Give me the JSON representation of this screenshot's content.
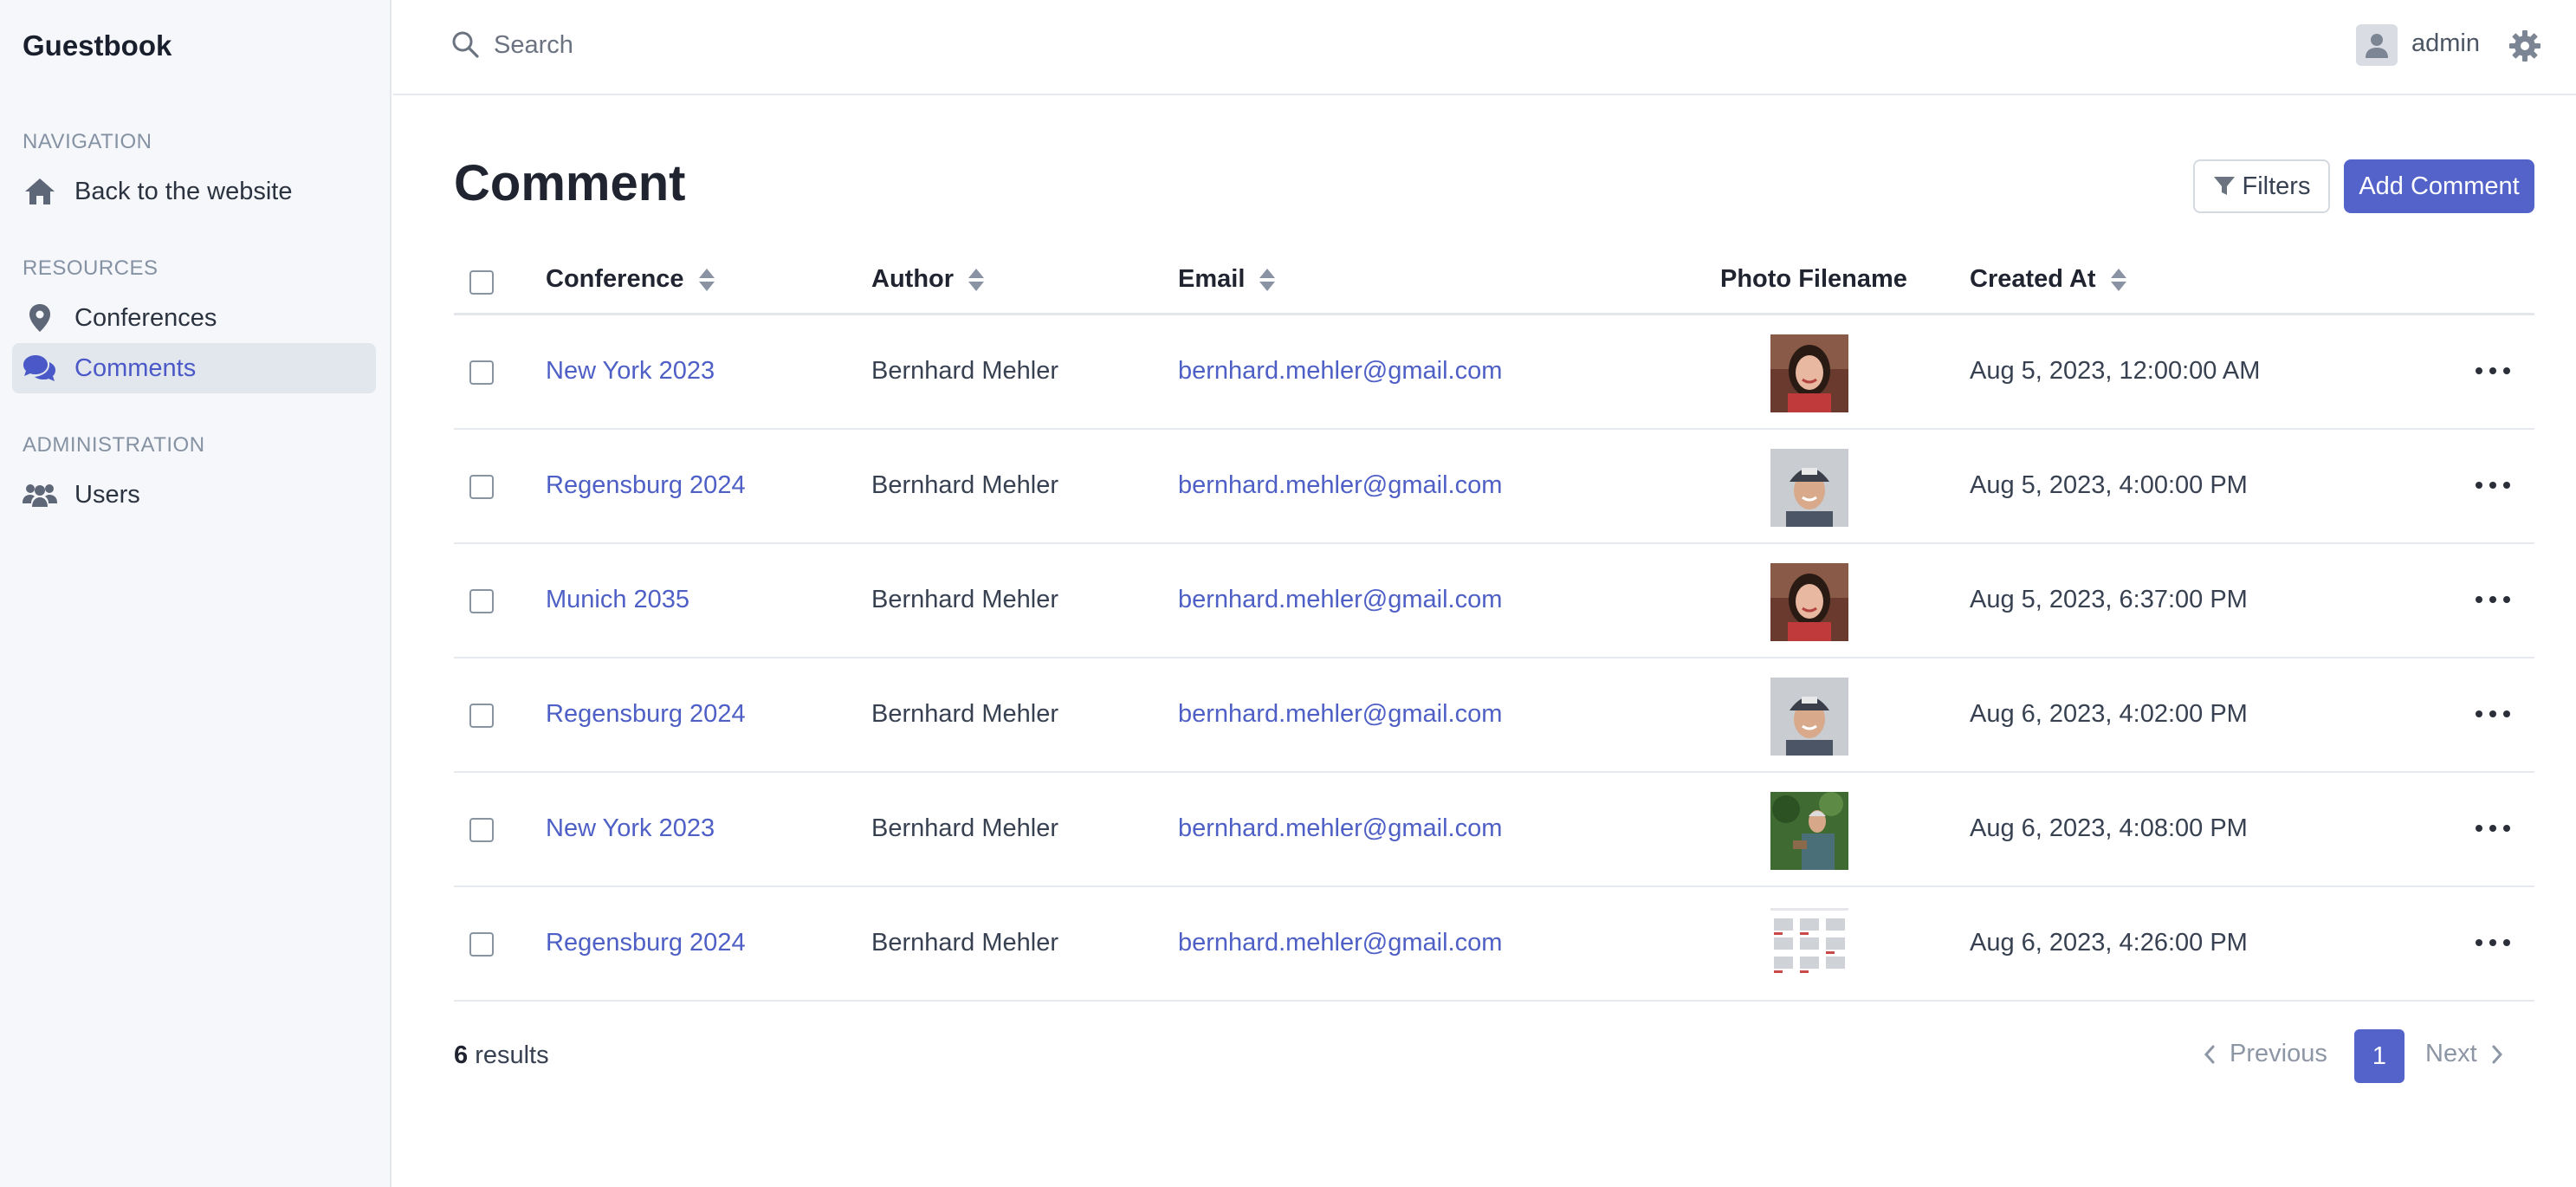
{
  "app": {
    "title": "Guestbook"
  },
  "sidebar": {
    "sections": [
      {
        "title": "NAVIGATION",
        "items": [
          {
            "label": "Back to the website",
            "icon": "home-icon"
          }
        ]
      },
      {
        "title": "RESOURCES",
        "items": [
          {
            "label": "Conferences",
            "icon": "map-pin-icon"
          },
          {
            "label": "Comments",
            "icon": "comments-icon",
            "active": true
          }
        ]
      },
      {
        "title": "ADMINISTRATION",
        "items": [
          {
            "label": "Users",
            "icon": "users-icon"
          }
        ]
      }
    ]
  },
  "topbar": {
    "search_placeholder": "Search",
    "user_name": "admin"
  },
  "page": {
    "title": "Comment",
    "filters_label": "Filters",
    "add_label": "Add Comment"
  },
  "table": {
    "columns": [
      "Conference",
      "Author",
      "Email",
      "Photo Filename",
      "Created At"
    ],
    "rows": [
      {
        "conference": "New York 2023",
        "author": "Bernhard Mehler",
        "email": "bernhard.mehler@gmail.com",
        "photo": "woman-portrait",
        "created": "Aug 5, 2023, 12:00:00 AM"
      },
      {
        "conference": "Regensburg 2024",
        "author": "Bernhard Mehler",
        "email": "bernhard.mehler@gmail.com",
        "photo": "man-cap-portrait",
        "created": "Aug 5, 2023, 4:00:00 PM"
      },
      {
        "conference": "Munich 2035",
        "author": "Bernhard Mehler",
        "email": "bernhard.mehler@gmail.com",
        "photo": "woman-portrait",
        "created": "Aug 5, 2023, 6:37:00 PM"
      },
      {
        "conference": "Regensburg 2024",
        "author": "Bernhard Mehler",
        "email": "bernhard.mehler@gmail.com",
        "photo": "man-cap-portrait",
        "created": "Aug 6, 2023, 4:02:00 PM"
      },
      {
        "conference": "New York 2023",
        "author": "Bernhard Mehler",
        "email": "bernhard.mehler@gmail.com",
        "photo": "man-outdoor-photo",
        "created": "Aug 6, 2023, 4:08:00 PM"
      },
      {
        "conference": "Regensburg 2024",
        "author": "Bernhard Mehler",
        "email": "bernhard.mehler@gmail.com",
        "photo": "document-screenshot",
        "created": "Aug 6, 2023, 4:26:00 PM"
      }
    ]
  },
  "footer": {
    "count": "6",
    "results_label": " results",
    "prev_label": "Previous",
    "page": "1",
    "next_label": "Next"
  },
  "colors": {
    "accent": "#5463c9",
    "link": "#4e5fc5",
    "sidebar_bg": "#f5f7fa"
  }
}
